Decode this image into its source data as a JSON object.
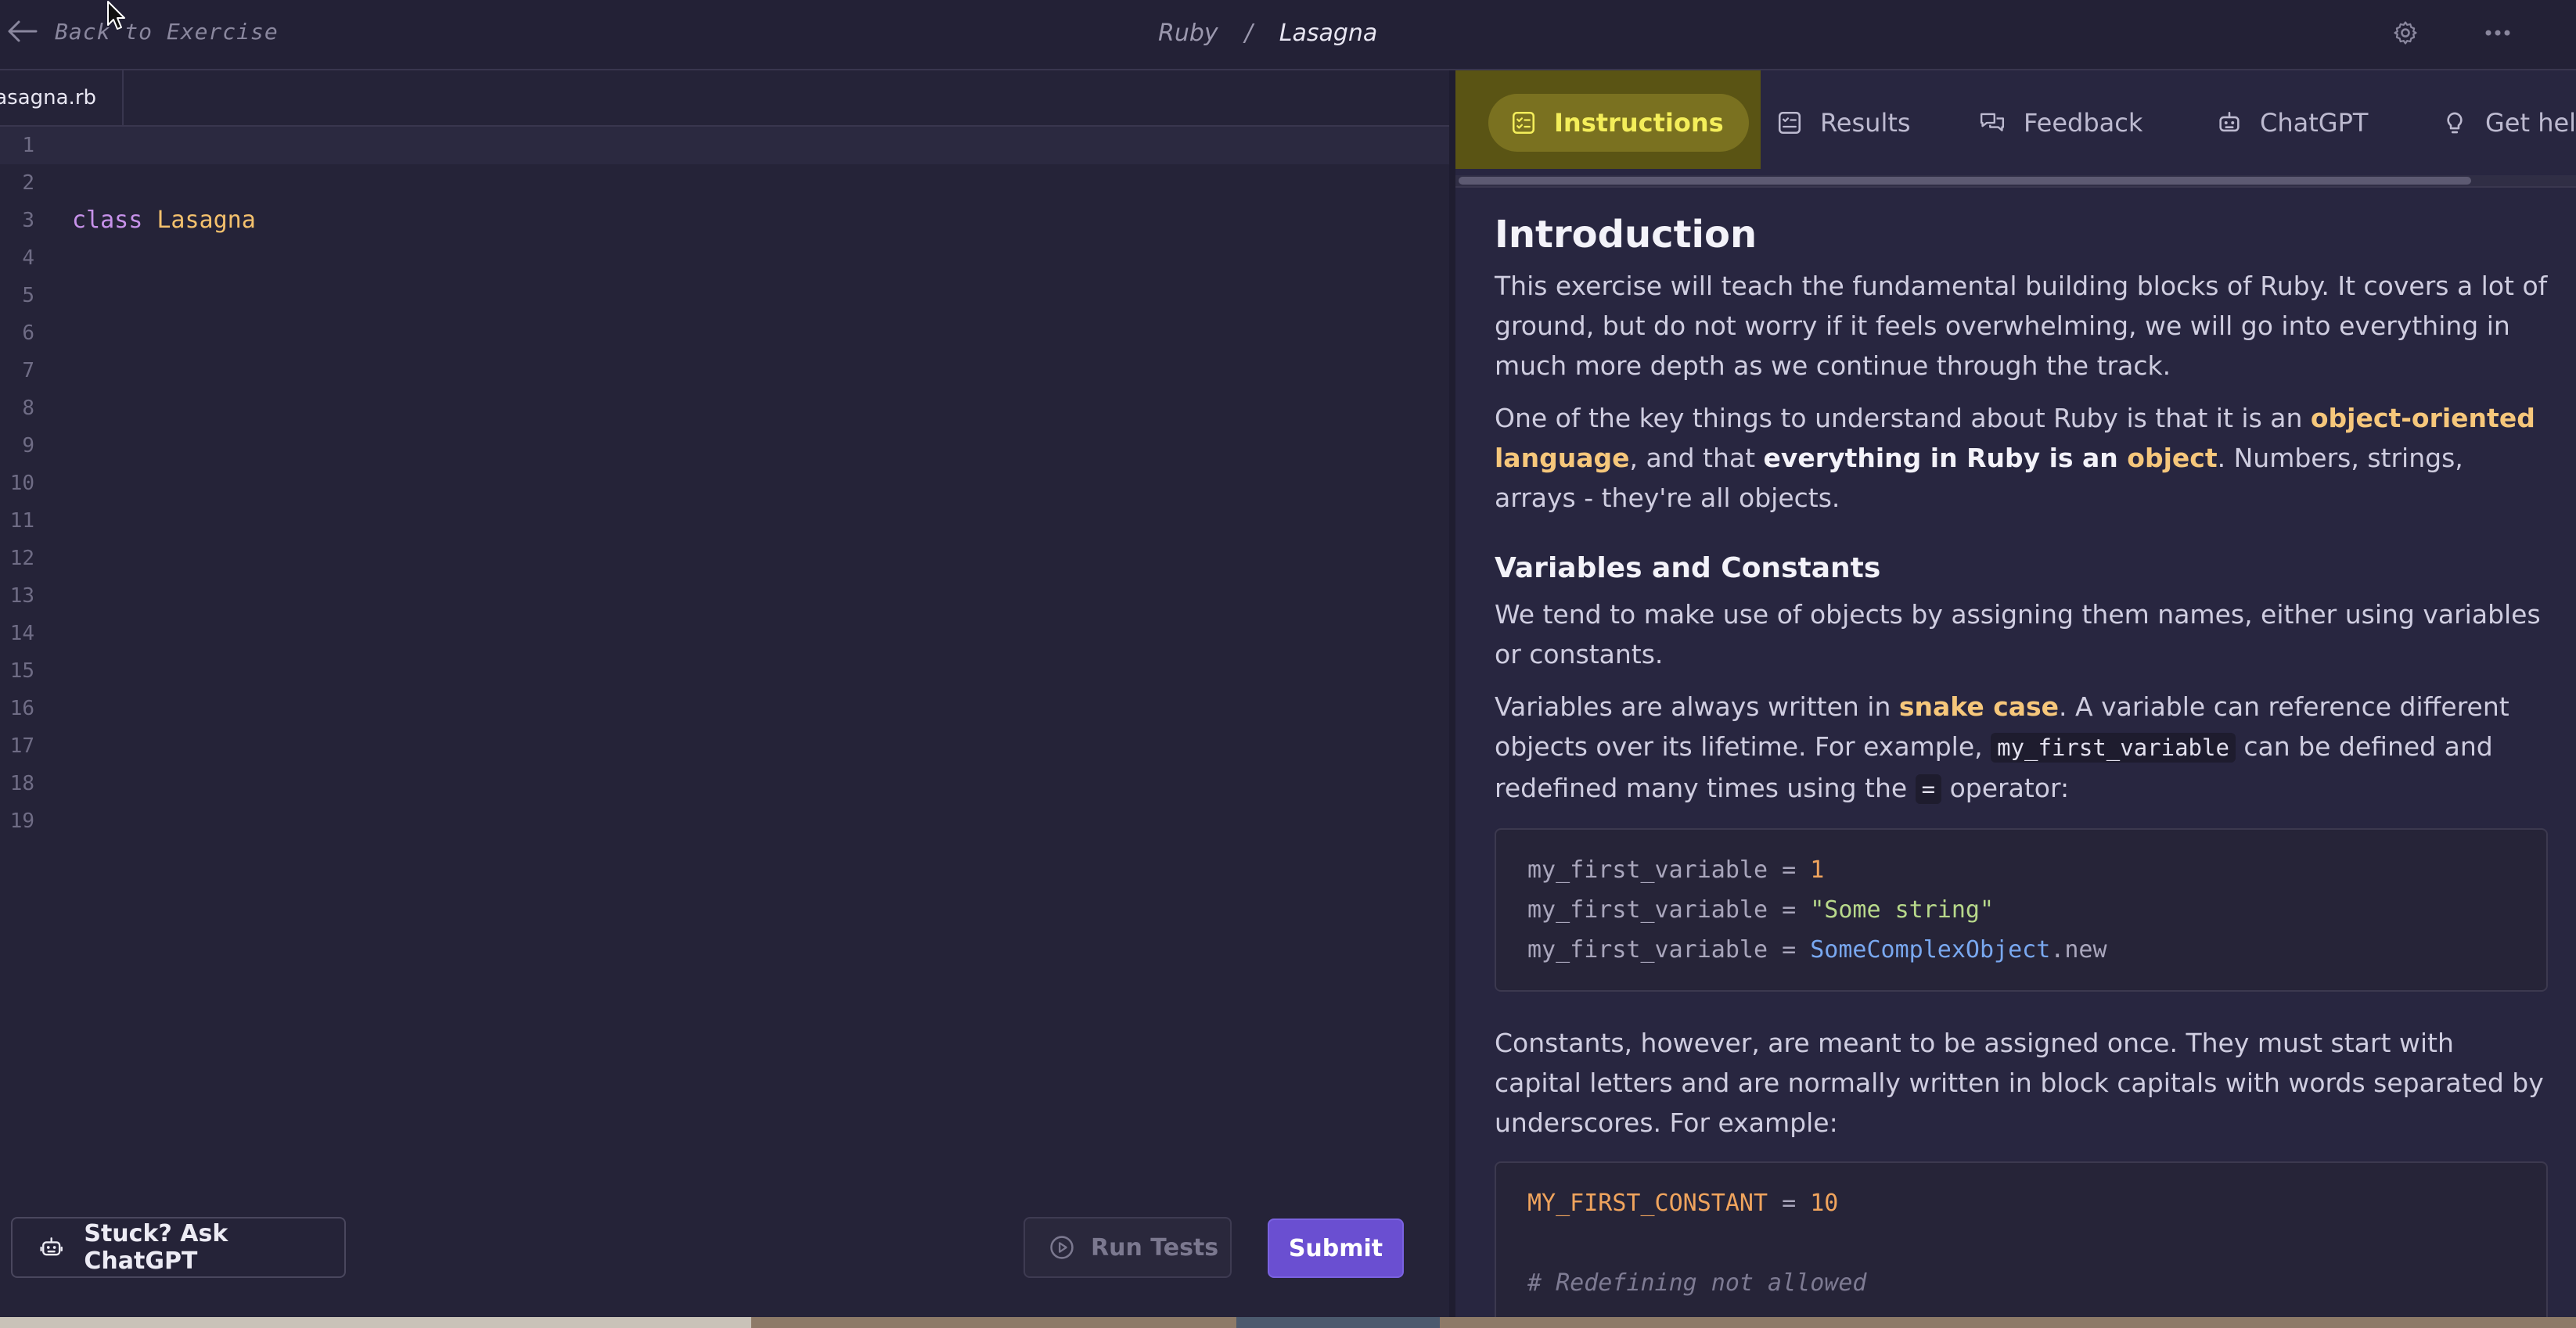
{
  "header": {
    "back_label": "Back to Exercise",
    "track": "Ruby",
    "separator": "/",
    "exercise": "Lasagna"
  },
  "editor": {
    "file_tab": "lasagna.rb",
    "line_numbers": [
      "1",
      "2",
      "3",
      "4",
      "5",
      "6",
      "7",
      "8",
      "9",
      "10",
      "11",
      "12",
      "13",
      "14",
      "15",
      "16",
      "17",
      "18",
      "19"
    ],
    "code_keyword": "class",
    "code_class_name": "Lasagna"
  },
  "actions": {
    "stuck_label": "Stuck? Ask ChatGPT",
    "run_tests_label": "Run Tests",
    "submit_label": "Submit"
  },
  "panel_tabs": {
    "instructions": "Instructions",
    "results": "Results",
    "feedback": "Feedback",
    "chatgpt": "ChatGPT",
    "get_help": "Get help"
  },
  "instructions": {
    "title": "Introduction",
    "p1": "This exercise will teach the fundamental building blocks of Ruby. It covers a lot of ground, but do not worry if it feels overwhelming, we will go into everything in much more depth as we continue through the track.",
    "p2_a": "One of the key things to understand about Ruby is that it is an ",
    "p2_b": "object-oriented language",
    "p2_c": ", and that ",
    "p2_d": "everything in Ruby is an ",
    "p2_e": "object",
    "p2_f": ". Numbers, strings, arrays - they're all objects.",
    "h2": "Variables and Constants",
    "p3": "We tend to make use of objects by assigning them names, either using variables or constants.",
    "p4_a": "Variables are always written in ",
    "p4_b": "snake case",
    "p4_c": ". A variable can reference different objects over its lifetime. For example, ",
    "p4_code1": "my_first_variable",
    "p4_d": " can be defined and redefined many times using the ",
    "p4_code2": "=",
    "p4_e": " operator:",
    "code1": {
      "l1_var": "my_first_variable = ",
      "l1_val": "1",
      "l2_var": "my_first_variable = ",
      "l2_val": "\"Some string\"",
      "l3_var": "my_first_variable = ",
      "l3_const": "SomeComplexObject",
      "l3_rest": ".new"
    },
    "p5": "Constants, however, are meant to be assigned once. They must start with capital letters and are normally written in block capitals with words separated by underscores. For example:",
    "code2": {
      "l1_const": "MY_FIRST_CONSTANT",
      "l1_eq": " = ",
      "l1_val": "10",
      "l3_comment": "# Redefining not allowed"
    }
  }
}
